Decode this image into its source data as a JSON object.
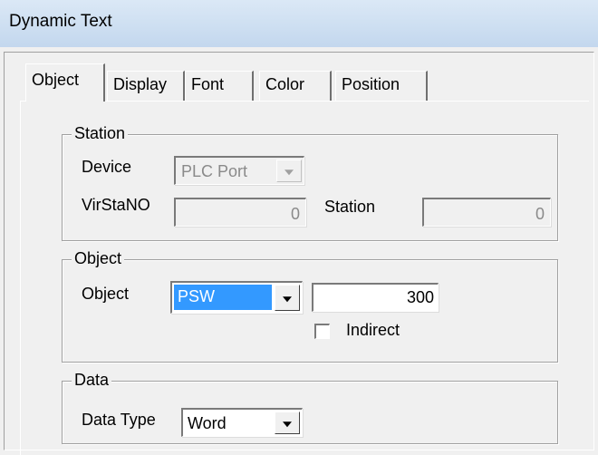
{
  "window": {
    "title": "Dynamic Text"
  },
  "tabs": [
    {
      "label": "Object",
      "active": true
    },
    {
      "label": "Display",
      "active": false
    },
    {
      "label": "Font",
      "active": false
    },
    {
      "label": "Color",
      "active": false
    },
    {
      "label": "Position",
      "active": false
    }
  ],
  "station_group": {
    "legend": "Station",
    "device_label": "Device",
    "device_value": "PLC Port",
    "virstano_label": "VirStaNO",
    "virstano_value": "0",
    "station_label": "Station",
    "station_value": "0"
  },
  "object_group": {
    "legend": "Object",
    "object_label": "Object",
    "object_type_value": "PSW",
    "address_value": "300",
    "indirect_label": "Indirect",
    "indirect_checked": false
  },
  "data_group": {
    "legend": "Data",
    "data_type_label": "Data Type",
    "data_type_value": "Word"
  },
  "colors": {
    "selection": "#3399ff",
    "disabled_text": "#8a8a8a"
  }
}
